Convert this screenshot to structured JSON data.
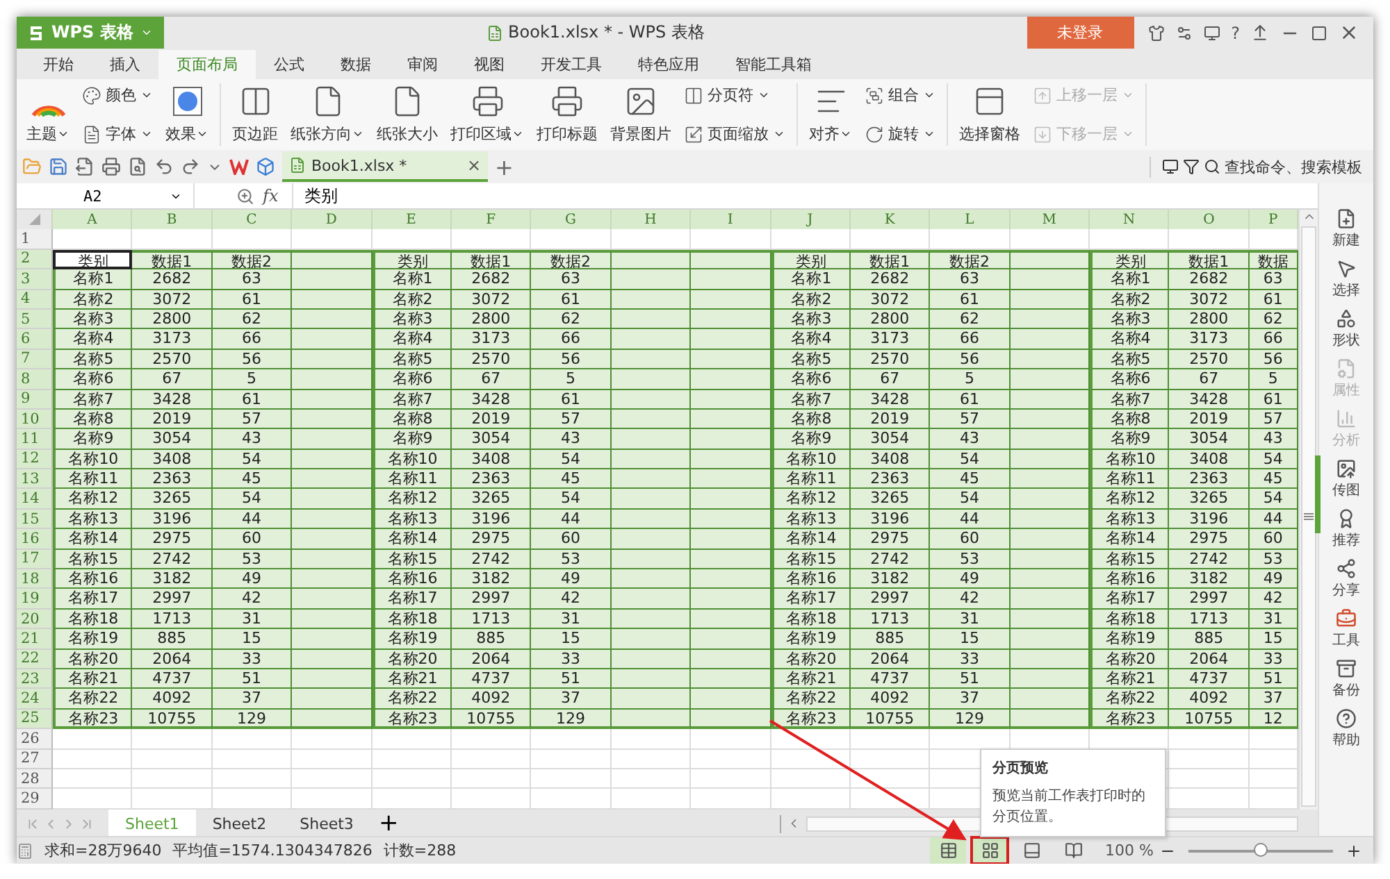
{
  "title_bar": {
    "app_menu": "WPS 表格",
    "title": "Book1.xlsx * - WPS 表格",
    "login": "未登录",
    "help": "?"
  },
  "menu_tabs": [
    {
      "label": "开始",
      "selected": false
    },
    {
      "label": "插入",
      "selected": false
    },
    {
      "label": "页面布局",
      "selected": true
    },
    {
      "label": "公式",
      "selected": false
    },
    {
      "label": "数据",
      "selected": false
    },
    {
      "label": "审阅",
      "selected": false
    },
    {
      "label": "视图",
      "selected": false
    },
    {
      "label": "开发工具",
      "selected": false
    },
    {
      "label": "特色应用",
      "selected": false
    },
    {
      "label": "智能工具箱",
      "selected": false
    }
  ],
  "ribbon": [
    {
      "kind": "big",
      "label": "主题",
      "dropdown": true
    },
    {
      "kind": "stack",
      "items": [
        {
          "label": "颜色",
          "dropdown": true,
          "disabled": false
        },
        {
          "label": "字体",
          "dropdown": true,
          "disabled": false
        }
      ]
    },
    {
      "kind": "big",
      "label": "效果",
      "dropdown": true
    },
    {
      "kind": "separator"
    },
    {
      "kind": "big",
      "label": "页边距",
      "dropdown": false
    },
    {
      "kind": "big",
      "label": "纸张方向",
      "dropdown": true
    },
    {
      "kind": "big",
      "label": "纸张大小",
      "dropdown": false
    },
    {
      "kind": "big",
      "label": "打印区域",
      "dropdown": true
    },
    {
      "kind": "big",
      "label": "打印标题",
      "dropdown": false
    },
    {
      "kind": "big",
      "label": "背景图片",
      "dropdown": false
    },
    {
      "kind": "stack",
      "items": [
        {
          "label": "分页符",
          "dropdown": true,
          "disabled": false
        },
        {
          "label": "页面缩放",
          "dropdown": true,
          "disabled": false
        }
      ]
    },
    {
      "kind": "separator"
    },
    {
      "kind": "big",
      "label": "对齐",
      "dropdown": true
    },
    {
      "kind": "stack",
      "items": [
        {
          "label": "组合",
          "dropdown": true,
          "disabled": false
        },
        {
          "label": "旋转",
          "dropdown": true,
          "disabled": false
        }
      ]
    },
    {
      "kind": "separator"
    },
    {
      "kind": "big",
      "label": "选择窗格",
      "dropdown": false
    },
    {
      "kind": "stack",
      "items": [
        {
          "label": "上移一层",
          "dropdown": true,
          "disabled": true
        },
        {
          "label": "下移一层",
          "dropdown": true,
          "disabled": true
        }
      ]
    },
    {
      "kind": "separator"
    }
  ],
  "doc_tab": {
    "label": "Book1.xlsx *",
    "close": "×",
    "add": "+"
  },
  "search": {
    "placeholder": "查找命令、搜索模板"
  },
  "formula_bar": {
    "name_box": "A2",
    "fx": "fx",
    "value": "类别"
  },
  "grid": {
    "column_headers": [
      "A",
      "B",
      "C",
      "D",
      "E",
      "F",
      "G",
      "H",
      "I",
      "J",
      "K",
      "L",
      "M",
      "N",
      "O",
      "P"
    ],
    "rows": [
      {
        "number": "1"
      },
      {
        "number": "2",
        "first_cell_active": true,
        "blocks": [
          [
            "类别",
            "数据1",
            "数据2"
          ],
          [
            "类别",
            "数据1",
            "数据2"
          ],
          [
            "类别",
            "数据1",
            "数据2"
          ],
          [
            "类别",
            "数据1",
            "数据"
          ]
        ]
      },
      {
        "number": "3",
        "blocks": [
          [
            "名称1",
            "2682",
            "63"
          ],
          [
            "名称1",
            "2682",
            "63"
          ],
          [
            "名称1",
            "2682",
            "63"
          ],
          [
            "名称1",
            "2682",
            "63"
          ]
        ]
      },
      {
        "number": "4",
        "blocks": [
          [
            "名称2",
            "3072",
            "61"
          ],
          [
            "名称2",
            "3072",
            "61"
          ],
          [
            "名称2",
            "3072",
            "61"
          ],
          [
            "名称2",
            "3072",
            "61"
          ]
        ]
      },
      {
        "number": "5",
        "blocks": [
          [
            "名称3",
            "2800",
            "62"
          ],
          [
            "名称3",
            "2800",
            "62"
          ],
          [
            "名称3",
            "2800",
            "62"
          ],
          [
            "名称3",
            "2800",
            "62"
          ]
        ]
      },
      {
        "number": "6",
        "blocks": [
          [
            "名称4",
            "3173",
            "66"
          ],
          [
            "名称4",
            "3173",
            "66"
          ],
          [
            "名称4",
            "3173",
            "66"
          ],
          [
            "名称4",
            "3173",
            "66"
          ]
        ]
      },
      {
        "number": "7",
        "blocks": [
          [
            "名称5",
            "2570",
            "56"
          ],
          [
            "名称5",
            "2570",
            "56"
          ],
          [
            "名称5",
            "2570",
            "56"
          ],
          [
            "名称5",
            "2570",
            "56"
          ]
        ]
      },
      {
        "number": "8",
        "blocks": [
          [
            "名称6",
            "67",
            "5"
          ],
          [
            "名称6",
            "67",
            "5"
          ],
          [
            "名称6",
            "67",
            "5"
          ],
          [
            "名称6",
            "67",
            "5"
          ]
        ]
      },
      {
        "number": "9",
        "blocks": [
          [
            "名称7",
            "3428",
            "61"
          ],
          [
            "名称7",
            "3428",
            "61"
          ],
          [
            "名称7",
            "3428",
            "61"
          ],
          [
            "名称7",
            "3428",
            "61"
          ]
        ]
      },
      {
        "number": "10",
        "blocks": [
          [
            "名称8",
            "2019",
            "57"
          ],
          [
            "名称8",
            "2019",
            "57"
          ],
          [
            "名称8",
            "2019",
            "57"
          ],
          [
            "名称8",
            "2019",
            "57"
          ]
        ]
      },
      {
        "number": "11",
        "blocks": [
          [
            "名称9",
            "3054",
            "43"
          ],
          [
            "名称9",
            "3054",
            "43"
          ],
          [
            "名称9",
            "3054",
            "43"
          ],
          [
            "名称9",
            "3054",
            "43"
          ]
        ]
      },
      {
        "number": "12",
        "blocks": [
          [
            "名称10",
            "3408",
            "54"
          ],
          [
            "名称10",
            "3408",
            "54"
          ],
          [
            "名称10",
            "3408",
            "54"
          ],
          [
            "名称10",
            "3408",
            "54"
          ]
        ]
      },
      {
        "number": "13",
        "blocks": [
          [
            "名称11",
            "2363",
            "45"
          ],
          [
            "名称11",
            "2363",
            "45"
          ],
          [
            "名称11",
            "2363",
            "45"
          ],
          [
            "名称11",
            "2363",
            "45"
          ]
        ]
      },
      {
        "number": "14",
        "blocks": [
          [
            "名称12",
            "3265",
            "54"
          ],
          [
            "名称12",
            "3265",
            "54"
          ],
          [
            "名称12",
            "3265",
            "54"
          ],
          [
            "名称12",
            "3265",
            "54"
          ]
        ]
      },
      {
        "number": "15",
        "blocks": [
          [
            "名称13",
            "3196",
            "44"
          ],
          [
            "名称13",
            "3196",
            "44"
          ],
          [
            "名称13",
            "3196",
            "44"
          ],
          [
            "名称13",
            "3196",
            "44"
          ]
        ]
      },
      {
        "number": "16",
        "blocks": [
          [
            "名称14",
            "2975",
            "60"
          ],
          [
            "名称14",
            "2975",
            "60"
          ],
          [
            "名称14",
            "2975",
            "60"
          ],
          [
            "名称14",
            "2975",
            "60"
          ]
        ]
      },
      {
        "number": "17",
        "blocks": [
          [
            "名称15",
            "2742",
            "53"
          ],
          [
            "名称15",
            "2742",
            "53"
          ],
          [
            "名称15",
            "2742",
            "53"
          ],
          [
            "名称15",
            "2742",
            "53"
          ]
        ]
      },
      {
        "number": "18",
        "blocks": [
          [
            "名称16",
            "3182",
            "49"
          ],
          [
            "名称16",
            "3182",
            "49"
          ],
          [
            "名称16",
            "3182",
            "49"
          ],
          [
            "名称16",
            "3182",
            "49"
          ]
        ]
      },
      {
        "number": "19",
        "blocks": [
          [
            "名称17",
            "2997",
            "42"
          ],
          [
            "名称17",
            "2997",
            "42"
          ],
          [
            "名称17",
            "2997",
            "42"
          ],
          [
            "名称17",
            "2997",
            "42"
          ]
        ]
      },
      {
        "number": "20",
        "blocks": [
          [
            "名称18",
            "1713",
            "31"
          ],
          [
            "名称18",
            "1713",
            "31"
          ],
          [
            "名称18",
            "1713",
            "31"
          ],
          [
            "名称18",
            "1713",
            "31"
          ]
        ]
      },
      {
        "number": "21",
        "blocks": [
          [
            "名称19",
            "885",
            "15"
          ],
          [
            "名称19",
            "885",
            "15"
          ],
          [
            "名称19",
            "885",
            "15"
          ],
          [
            "名称19",
            "885",
            "15"
          ]
        ]
      },
      {
        "number": "22",
        "blocks": [
          [
            "名称20",
            "2064",
            "33"
          ],
          [
            "名称20",
            "2064",
            "33"
          ],
          [
            "名称20",
            "2064",
            "33"
          ],
          [
            "名称20",
            "2064",
            "33"
          ]
        ]
      },
      {
        "number": "23",
        "blocks": [
          [
            "名称21",
            "4737",
            "51"
          ],
          [
            "名称21",
            "4737",
            "51"
          ],
          [
            "名称21",
            "4737",
            "51"
          ],
          [
            "名称21",
            "4737",
            "51"
          ]
        ]
      },
      {
        "number": "24",
        "blocks": [
          [
            "名称22",
            "4092",
            "37"
          ],
          [
            "名称22",
            "4092",
            "37"
          ],
          [
            "名称22",
            "4092",
            "37"
          ],
          [
            "名称22",
            "4092",
            "37"
          ]
        ]
      },
      {
        "number": "25",
        "blocks": [
          [
            "名称23",
            "10755",
            "129"
          ],
          [
            "名称23",
            "10755",
            "129"
          ],
          [
            "名称23",
            "10755",
            "129"
          ],
          [
            "名称23",
            "10755",
            "12"
          ]
        ]
      },
      {
        "number": "26"
      },
      {
        "number": "27"
      },
      {
        "number": "28"
      },
      {
        "number": "29"
      }
    ]
  },
  "sheet_tabs": {
    "tabs": [
      {
        "label": "Sheet1",
        "selected": true
      },
      {
        "label": "Sheet2",
        "selected": false
      },
      {
        "label": "Sheet3",
        "selected": false
      }
    ],
    "add": "+"
  },
  "sidebar": [
    {
      "label": "新建",
      "disabled": false
    },
    {
      "label": "选择",
      "disabled": false
    },
    {
      "label": "形状",
      "disabled": false
    },
    {
      "label": "属性",
      "disabled": true
    },
    {
      "label": "分析",
      "disabled": true
    },
    {
      "label": "传图",
      "disabled": false
    },
    {
      "label": "推荐",
      "disabled": false
    },
    {
      "label": "分享",
      "disabled": false
    },
    {
      "label": "工具",
      "disabled": false
    },
    {
      "label": "备份",
      "disabled": false
    },
    {
      "label": "帮助",
      "disabled": false
    }
  ],
  "status_bar": {
    "stats": [
      "求和=28万9640",
      "平均值=1574.1304347826",
      "计数=288"
    ],
    "views": [
      {
        "selected": true,
        "highlighted": false
      },
      {
        "selected": true,
        "highlighted": true
      },
      {
        "selected": false,
        "highlighted": false
      },
      {
        "selected": false,
        "highlighted": false
      }
    ],
    "zoom": "100 %",
    "zoom_slider": {
      "level": 0.5
    }
  },
  "tooltip": {
    "title": "分页预览",
    "text": "预览当前工作表打印时的分页位置。"
  }
}
